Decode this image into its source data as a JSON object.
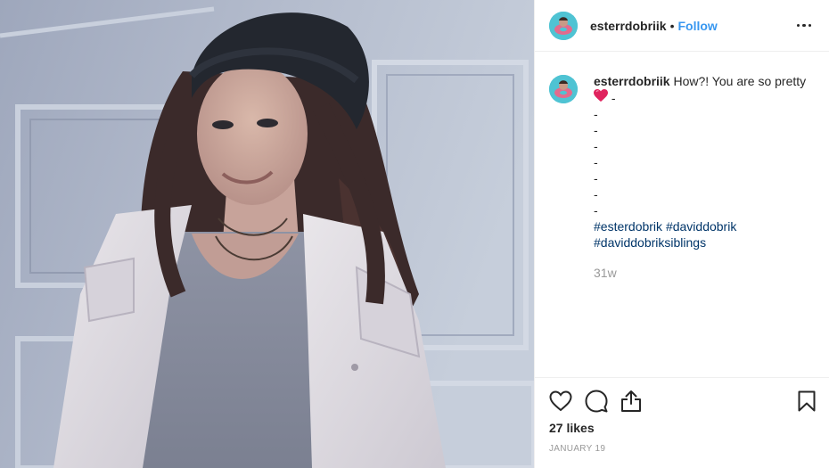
{
  "post": {
    "username": "esterrdobriik",
    "follow_label": "Follow",
    "separator": "•",
    "caption": {
      "text": "How?! You are so pretty",
      "dash_after_heart": "-",
      "dash_lines": [
        "-",
        "-",
        "-",
        "-",
        "-",
        "-",
        "-"
      ],
      "hashtags_line1": [
        "#esterdobrik",
        "#daviddobrik"
      ],
      "hashtags_line2": [
        "#daviddobriksiblings"
      ]
    },
    "time_ago": "31w",
    "likes": "27 likes",
    "date": "JANUARY 19"
  },
  "icons": {
    "more": "more-options-icon",
    "like": "heart-outline-icon",
    "comment": "comment-bubble-icon",
    "share": "share-upload-icon",
    "save": "bookmark-icon",
    "heart_emoji": "red-heart-emoji-icon"
  },
  "colors": {
    "link_blue": "#3897f0",
    "hashtag_navy": "#003569",
    "muted_gray": "#999999",
    "text": "#262626",
    "heart_red": "#e0245e",
    "avatar_bg": "#4fc3d3"
  }
}
